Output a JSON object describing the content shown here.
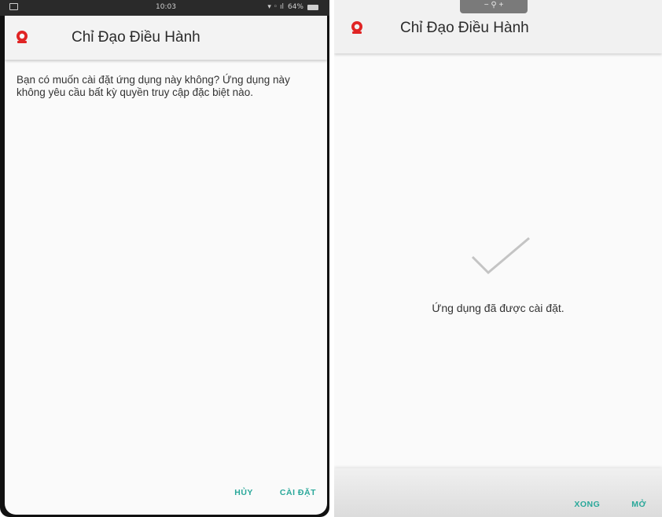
{
  "left": {
    "status_bar": {
      "time": "10:03",
      "battery": "64%"
    },
    "app_title": "Chỉ Đạo Điều Hành",
    "message": "Bạn có muốn cài đặt ứng dụng này không? Ứng dụng này không yêu cầu bất kỳ quyền truy cập đặc biệt nào.",
    "cancel_label": "HỦY",
    "install_label": "CÀI ĐẶT"
  },
  "right": {
    "app_title": "Chỉ Đạo Điều Hành",
    "installed_message": "Ứng dụng đã được cài đặt.",
    "done_label": "XONG",
    "open_label": "MỞ"
  },
  "colors": {
    "accent": "#2aa89a",
    "logo": "#e02424",
    "checkmark": "#c4c4c4"
  },
  "icons": [
    "app-logo-icon",
    "checkmark-icon"
  ]
}
